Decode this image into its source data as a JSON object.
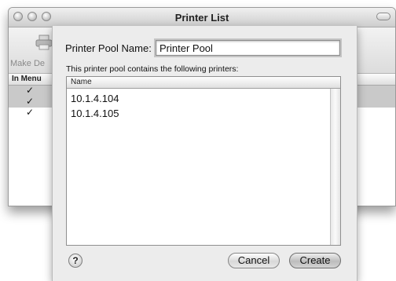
{
  "window": {
    "title": "Printer List",
    "toolbar_label": "Make De",
    "column_in_menu": "In Menu",
    "checkmark": "✓",
    "rows": [
      {
        "checked": true,
        "selected": true
      },
      {
        "checked": true,
        "selected": true
      },
      {
        "checked": true,
        "selected": false
      }
    ]
  },
  "sheet": {
    "pool_name_label": "Printer Pool Name:",
    "pool_name_value": "Printer Pool",
    "description": "This printer pool contains the following printers:",
    "table_header": "Name",
    "printers": [
      "10.1.4.104",
      "10.1.4.105"
    ],
    "help_label": "?",
    "cancel_label": "Cancel",
    "create_label": "Create"
  },
  "colors": {
    "selection": "#c9c9c9",
    "sheet_bg": "#ececec"
  }
}
